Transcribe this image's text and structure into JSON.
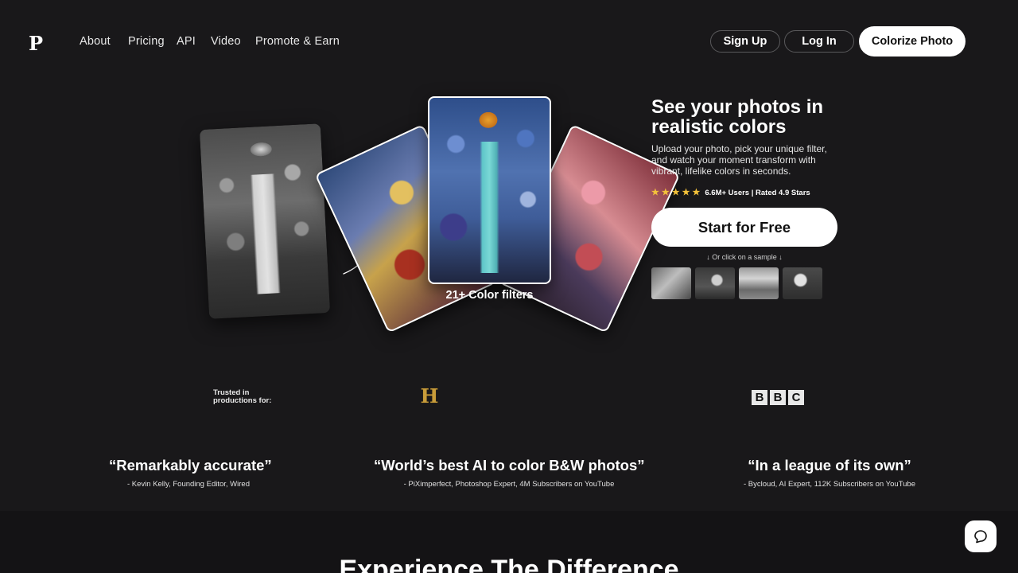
{
  "nav": {
    "logo": "P",
    "links": [
      "About",
      "Pricing",
      "API",
      "Video",
      "Promote & Earn"
    ],
    "signup": "Sign Up",
    "login": "Log In",
    "colorize": "Colorize Photo"
  },
  "hero": {
    "title": "See your photos in realistic colors",
    "description": "Upload your photo, pick your unique filter, and watch your moment transform with vibrant, lifelike colors in seconds.",
    "rating_text": "6.6M+ Users | Rated 4.9 Stars",
    "stars": 5,
    "cta": "Start for Free",
    "sample_hint": "↓ Or click on a sample ↓",
    "filters_caption": "21+ Color filters"
  },
  "trusted": {
    "label": "Trusted in productions for:",
    "history_logo": "H",
    "bbc_letters": [
      "B",
      "B",
      "C"
    ]
  },
  "quotes": [
    {
      "text": "“Remarkably accurate”",
      "author": "- Kevin Kelly, Founding Editor, Wired"
    },
    {
      "text": "“World’s best AI to color B&W photos”",
      "author": "- PiXimperfect, Photoshop Expert, 4M Subscribers on YouTube"
    },
    {
      "text": "“In a league of its own”",
      "author": "- Bycloud, AI Expert, 112K Subscribers on YouTube"
    }
  ],
  "section_title": "Experience The Difference",
  "colors": {
    "background": "#19181a",
    "star": "#f3c13a",
    "history_gold": "#c89c3a"
  },
  "icons": {
    "chat": "chat-bubble-icon",
    "arrow": "curly-arrow-icon",
    "star": "star-icon"
  }
}
